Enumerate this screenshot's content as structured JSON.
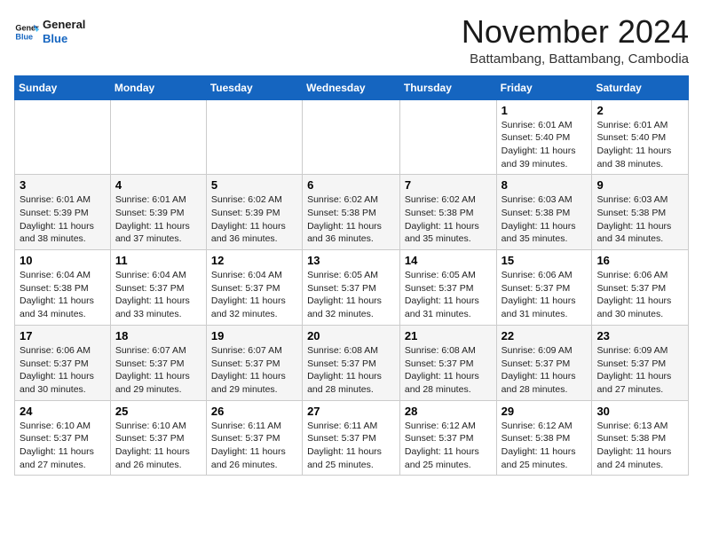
{
  "header": {
    "logo_line1": "General",
    "logo_line2": "Blue",
    "month_title": "November 2024",
    "subtitle": "Battambang, Battambang, Cambodia"
  },
  "weekdays": [
    "Sunday",
    "Monday",
    "Tuesday",
    "Wednesday",
    "Thursday",
    "Friday",
    "Saturday"
  ],
  "weeks": [
    [
      {
        "day": "",
        "info": ""
      },
      {
        "day": "",
        "info": ""
      },
      {
        "day": "",
        "info": ""
      },
      {
        "day": "",
        "info": ""
      },
      {
        "day": "",
        "info": ""
      },
      {
        "day": "1",
        "info": "Sunrise: 6:01 AM\nSunset: 5:40 PM\nDaylight: 11 hours\nand 39 minutes."
      },
      {
        "day": "2",
        "info": "Sunrise: 6:01 AM\nSunset: 5:40 PM\nDaylight: 11 hours\nand 38 minutes."
      }
    ],
    [
      {
        "day": "3",
        "info": "Sunrise: 6:01 AM\nSunset: 5:39 PM\nDaylight: 11 hours\nand 38 minutes."
      },
      {
        "day": "4",
        "info": "Sunrise: 6:01 AM\nSunset: 5:39 PM\nDaylight: 11 hours\nand 37 minutes."
      },
      {
        "day": "5",
        "info": "Sunrise: 6:02 AM\nSunset: 5:39 PM\nDaylight: 11 hours\nand 36 minutes."
      },
      {
        "day": "6",
        "info": "Sunrise: 6:02 AM\nSunset: 5:38 PM\nDaylight: 11 hours\nand 36 minutes."
      },
      {
        "day": "7",
        "info": "Sunrise: 6:02 AM\nSunset: 5:38 PM\nDaylight: 11 hours\nand 35 minutes."
      },
      {
        "day": "8",
        "info": "Sunrise: 6:03 AM\nSunset: 5:38 PM\nDaylight: 11 hours\nand 35 minutes."
      },
      {
        "day": "9",
        "info": "Sunrise: 6:03 AM\nSunset: 5:38 PM\nDaylight: 11 hours\nand 34 minutes."
      }
    ],
    [
      {
        "day": "10",
        "info": "Sunrise: 6:04 AM\nSunset: 5:38 PM\nDaylight: 11 hours\nand 34 minutes."
      },
      {
        "day": "11",
        "info": "Sunrise: 6:04 AM\nSunset: 5:37 PM\nDaylight: 11 hours\nand 33 minutes."
      },
      {
        "day": "12",
        "info": "Sunrise: 6:04 AM\nSunset: 5:37 PM\nDaylight: 11 hours\nand 32 minutes."
      },
      {
        "day": "13",
        "info": "Sunrise: 6:05 AM\nSunset: 5:37 PM\nDaylight: 11 hours\nand 32 minutes."
      },
      {
        "day": "14",
        "info": "Sunrise: 6:05 AM\nSunset: 5:37 PM\nDaylight: 11 hours\nand 31 minutes."
      },
      {
        "day": "15",
        "info": "Sunrise: 6:06 AM\nSunset: 5:37 PM\nDaylight: 11 hours\nand 31 minutes."
      },
      {
        "day": "16",
        "info": "Sunrise: 6:06 AM\nSunset: 5:37 PM\nDaylight: 11 hours\nand 30 minutes."
      }
    ],
    [
      {
        "day": "17",
        "info": "Sunrise: 6:06 AM\nSunset: 5:37 PM\nDaylight: 11 hours\nand 30 minutes."
      },
      {
        "day": "18",
        "info": "Sunrise: 6:07 AM\nSunset: 5:37 PM\nDaylight: 11 hours\nand 29 minutes."
      },
      {
        "day": "19",
        "info": "Sunrise: 6:07 AM\nSunset: 5:37 PM\nDaylight: 11 hours\nand 29 minutes."
      },
      {
        "day": "20",
        "info": "Sunrise: 6:08 AM\nSunset: 5:37 PM\nDaylight: 11 hours\nand 28 minutes."
      },
      {
        "day": "21",
        "info": "Sunrise: 6:08 AM\nSunset: 5:37 PM\nDaylight: 11 hours\nand 28 minutes."
      },
      {
        "day": "22",
        "info": "Sunrise: 6:09 AM\nSunset: 5:37 PM\nDaylight: 11 hours\nand 28 minutes."
      },
      {
        "day": "23",
        "info": "Sunrise: 6:09 AM\nSunset: 5:37 PM\nDaylight: 11 hours\nand 27 minutes."
      }
    ],
    [
      {
        "day": "24",
        "info": "Sunrise: 6:10 AM\nSunset: 5:37 PM\nDaylight: 11 hours\nand 27 minutes."
      },
      {
        "day": "25",
        "info": "Sunrise: 6:10 AM\nSunset: 5:37 PM\nDaylight: 11 hours\nand 26 minutes."
      },
      {
        "day": "26",
        "info": "Sunrise: 6:11 AM\nSunset: 5:37 PM\nDaylight: 11 hours\nand 26 minutes."
      },
      {
        "day": "27",
        "info": "Sunrise: 6:11 AM\nSunset: 5:37 PM\nDaylight: 11 hours\nand 25 minutes."
      },
      {
        "day": "28",
        "info": "Sunrise: 6:12 AM\nSunset: 5:37 PM\nDaylight: 11 hours\nand 25 minutes."
      },
      {
        "day": "29",
        "info": "Sunrise: 6:12 AM\nSunset: 5:38 PM\nDaylight: 11 hours\nand 25 minutes."
      },
      {
        "day": "30",
        "info": "Sunrise: 6:13 AM\nSunset: 5:38 PM\nDaylight: 11 hours\nand 24 minutes."
      }
    ]
  ]
}
